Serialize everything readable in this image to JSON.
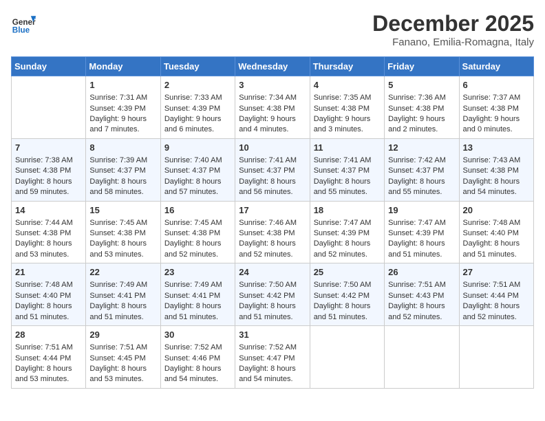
{
  "header": {
    "logo_general": "General",
    "logo_blue": "Blue",
    "month_title": "December 2025",
    "subtitle": "Fanano, Emilia-Romagna, Italy"
  },
  "weekdays": [
    "Sunday",
    "Monday",
    "Tuesday",
    "Wednesday",
    "Thursday",
    "Friday",
    "Saturday"
  ],
  "weeks": [
    [
      {
        "day": "",
        "info": ""
      },
      {
        "day": "1",
        "info": "Sunrise: 7:31 AM\nSunset: 4:39 PM\nDaylight: 9 hours\nand 7 minutes."
      },
      {
        "day": "2",
        "info": "Sunrise: 7:33 AM\nSunset: 4:39 PM\nDaylight: 9 hours\nand 6 minutes."
      },
      {
        "day": "3",
        "info": "Sunrise: 7:34 AM\nSunset: 4:38 PM\nDaylight: 9 hours\nand 4 minutes."
      },
      {
        "day": "4",
        "info": "Sunrise: 7:35 AM\nSunset: 4:38 PM\nDaylight: 9 hours\nand 3 minutes."
      },
      {
        "day": "5",
        "info": "Sunrise: 7:36 AM\nSunset: 4:38 PM\nDaylight: 9 hours\nand 2 minutes."
      },
      {
        "day": "6",
        "info": "Sunrise: 7:37 AM\nSunset: 4:38 PM\nDaylight: 9 hours\nand 0 minutes."
      }
    ],
    [
      {
        "day": "7",
        "info": "Sunrise: 7:38 AM\nSunset: 4:38 PM\nDaylight: 8 hours\nand 59 minutes."
      },
      {
        "day": "8",
        "info": "Sunrise: 7:39 AM\nSunset: 4:37 PM\nDaylight: 8 hours\nand 58 minutes."
      },
      {
        "day": "9",
        "info": "Sunrise: 7:40 AM\nSunset: 4:37 PM\nDaylight: 8 hours\nand 57 minutes."
      },
      {
        "day": "10",
        "info": "Sunrise: 7:41 AM\nSunset: 4:37 PM\nDaylight: 8 hours\nand 56 minutes."
      },
      {
        "day": "11",
        "info": "Sunrise: 7:41 AM\nSunset: 4:37 PM\nDaylight: 8 hours\nand 55 minutes."
      },
      {
        "day": "12",
        "info": "Sunrise: 7:42 AM\nSunset: 4:37 PM\nDaylight: 8 hours\nand 55 minutes."
      },
      {
        "day": "13",
        "info": "Sunrise: 7:43 AM\nSunset: 4:38 PM\nDaylight: 8 hours\nand 54 minutes."
      }
    ],
    [
      {
        "day": "14",
        "info": "Sunrise: 7:44 AM\nSunset: 4:38 PM\nDaylight: 8 hours\nand 53 minutes."
      },
      {
        "day": "15",
        "info": "Sunrise: 7:45 AM\nSunset: 4:38 PM\nDaylight: 8 hours\nand 53 minutes."
      },
      {
        "day": "16",
        "info": "Sunrise: 7:45 AM\nSunset: 4:38 PM\nDaylight: 8 hours\nand 52 minutes."
      },
      {
        "day": "17",
        "info": "Sunrise: 7:46 AM\nSunset: 4:38 PM\nDaylight: 8 hours\nand 52 minutes."
      },
      {
        "day": "18",
        "info": "Sunrise: 7:47 AM\nSunset: 4:39 PM\nDaylight: 8 hours\nand 52 minutes."
      },
      {
        "day": "19",
        "info": "Sunrise: 7:47 AM\nSunset: 4:39 PM\nDaylight: 8 hours\nand 51 minutes."
      },
      {
        "day": "20",
        "info": "Sunrise: 7:48 AM\nSunset: 4:40 PM\nDaylight: 8 hours\nand 51 minutes."
      }
    ],
    [
      {
        "day": "21",
        "info": "Sunrise: 7:48 AM\nSunset: 4:40 PM\nDaylight: 8 hours\nand 51 minutes."
      },
      {
        "day": "22",
        "info": "Sunrise: 7:49 AM\nSunset: 4:41 PM\nDaylight: 8 hours\nand 51 minutes."
      },
      {
        "day": "23",
        "info": "Sunrise: 7:49 AM\nSunset: 4:41 PM\nDaylight: 8 hours\nand 51 minutes."
      },
      {
        "day": "24",
        "info": "Sunrise: 7:50 AM\nSunset: 4:42 PM\nDaylight: 8 hours\nand 51 minutes."
      },
      {
        "day": "25",
        "info": "Sunrise: 7:50 AM\nSunset: 4:42 PM\nDaylight: 8 hours\nand 51 minutes."
      },
      {
        "day": "26",
        "info": "Sunrise: 7:51 AM\nSunset: 4:43 PM\nDaylight: 8 hours\nand 52 minutes."
      },
      {
        "day": "27",
        "info": "Sunrise: 7:51 AM\nSunset: 4:44 PM\nDaylight: 8 hours\nand 52 minutes."
      }
    ],
    [
      {
        "day": "28",
        "info": "Sunrise: 7:51 AM\nSunset: 4:44 PM\nDaylight: 8 hours\nand 53 minutes."
      },
      {
        "day": "29",
        "info": "Sunrise: 7:51 AM\nSunset: 4:45 PM\nDaylight: 8 hours\nand 53 minutes."
      },
      {
        "day": "30",
        "info": "Sunrise: 7:52 AM\nSunset: 4:46 PM\nDaylight: 8 hours\nand 54 minutes."
      },
      {
        "day": "31",
        "info": "Sunrise: 7:52 AM\nSunset: 4:47 PM\nDaylight: 8 hours\nand 54 minutes."
      },
      {
        "day": "",
        "info": ""
      },
      {
        "day": "",
        "info": ""
      },
      {
        "day": "",
        "info": ""
      }
    ]
  ]
}
